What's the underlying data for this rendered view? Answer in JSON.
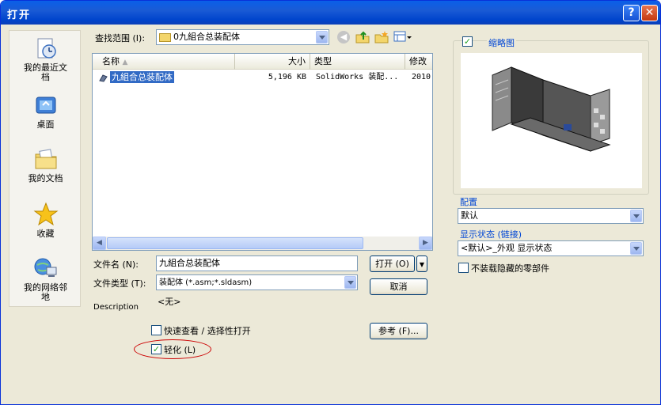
{
  "window": {
    "title": "打开"
  },
  "places": [
    {
      "label": "我的最近文档",
      "icon": "recent-documents-icon"
    },
    {
      "label": "桌面",
      "icon": "desktop-icon"
    },
    {
      "label": "我的文档",
      "icon": "my-documents-icon"
    },
    {
      "label": "收藏",
      "icon": "favorites-star-icon"
    },
    {
      "label": "我的网络邻地",
      "icon": "network-places-icon"
    }
  ],
  "look_in": {
    "label": "查找范围 (I):",
    "value": "0九組合总装配体"
  },
  "file_list": {
    "columns": [
      "名称",
      "大小",
      "类型",
      "修改"
    ],
    "rows": [
      {
        "name": "九組合总装配体",
        "size": "5,196 KB",
        "type": "SolidWorks 装配...",
        "modified": "2010"
      }
    ]
  },
  "file_name": {
    "label": "文件名 (N):",
    "value": "九組合总装配体"
  },
  "file_type": {
    "label": "文件类型 (T):",
    "value": "装配体 (*.asm;*.sldasm)"
  },
  "description": {
    "label": "Description",
    "value": "<无>"
  },
  "buttons": {
    "open": "打开 (O)",
    "cancel": "取消",
    "references": "参考 (F)..."
  },
  "quick_view": {
    "label": "快速查看 / 选择性打开",
    "checked": false
  },
  "lightweight": {
    "label": "轻化 (L)",
    "checked": true
  },
  "thumbnail": {
    "label": "缩略图",
    "checked": true
  },
  "configuration": {
    "label": "配置",
    "value": "默认"
  },
  "display_state": {
    "label": "显示状态 (链接)",
    "value": "<默认>_外观 显示状态"
  },
  "hidden_parts": {
    "label": "不装载隐藏的零部件",
    "checked": false
  },
  "colors": {
    "title_bar": "#0a5fe8",
    "dialog_bg": "#ece9d8",
    "selection": "#316ac5",
    "highlight_ellipse": "#cc0000"
  }
}
